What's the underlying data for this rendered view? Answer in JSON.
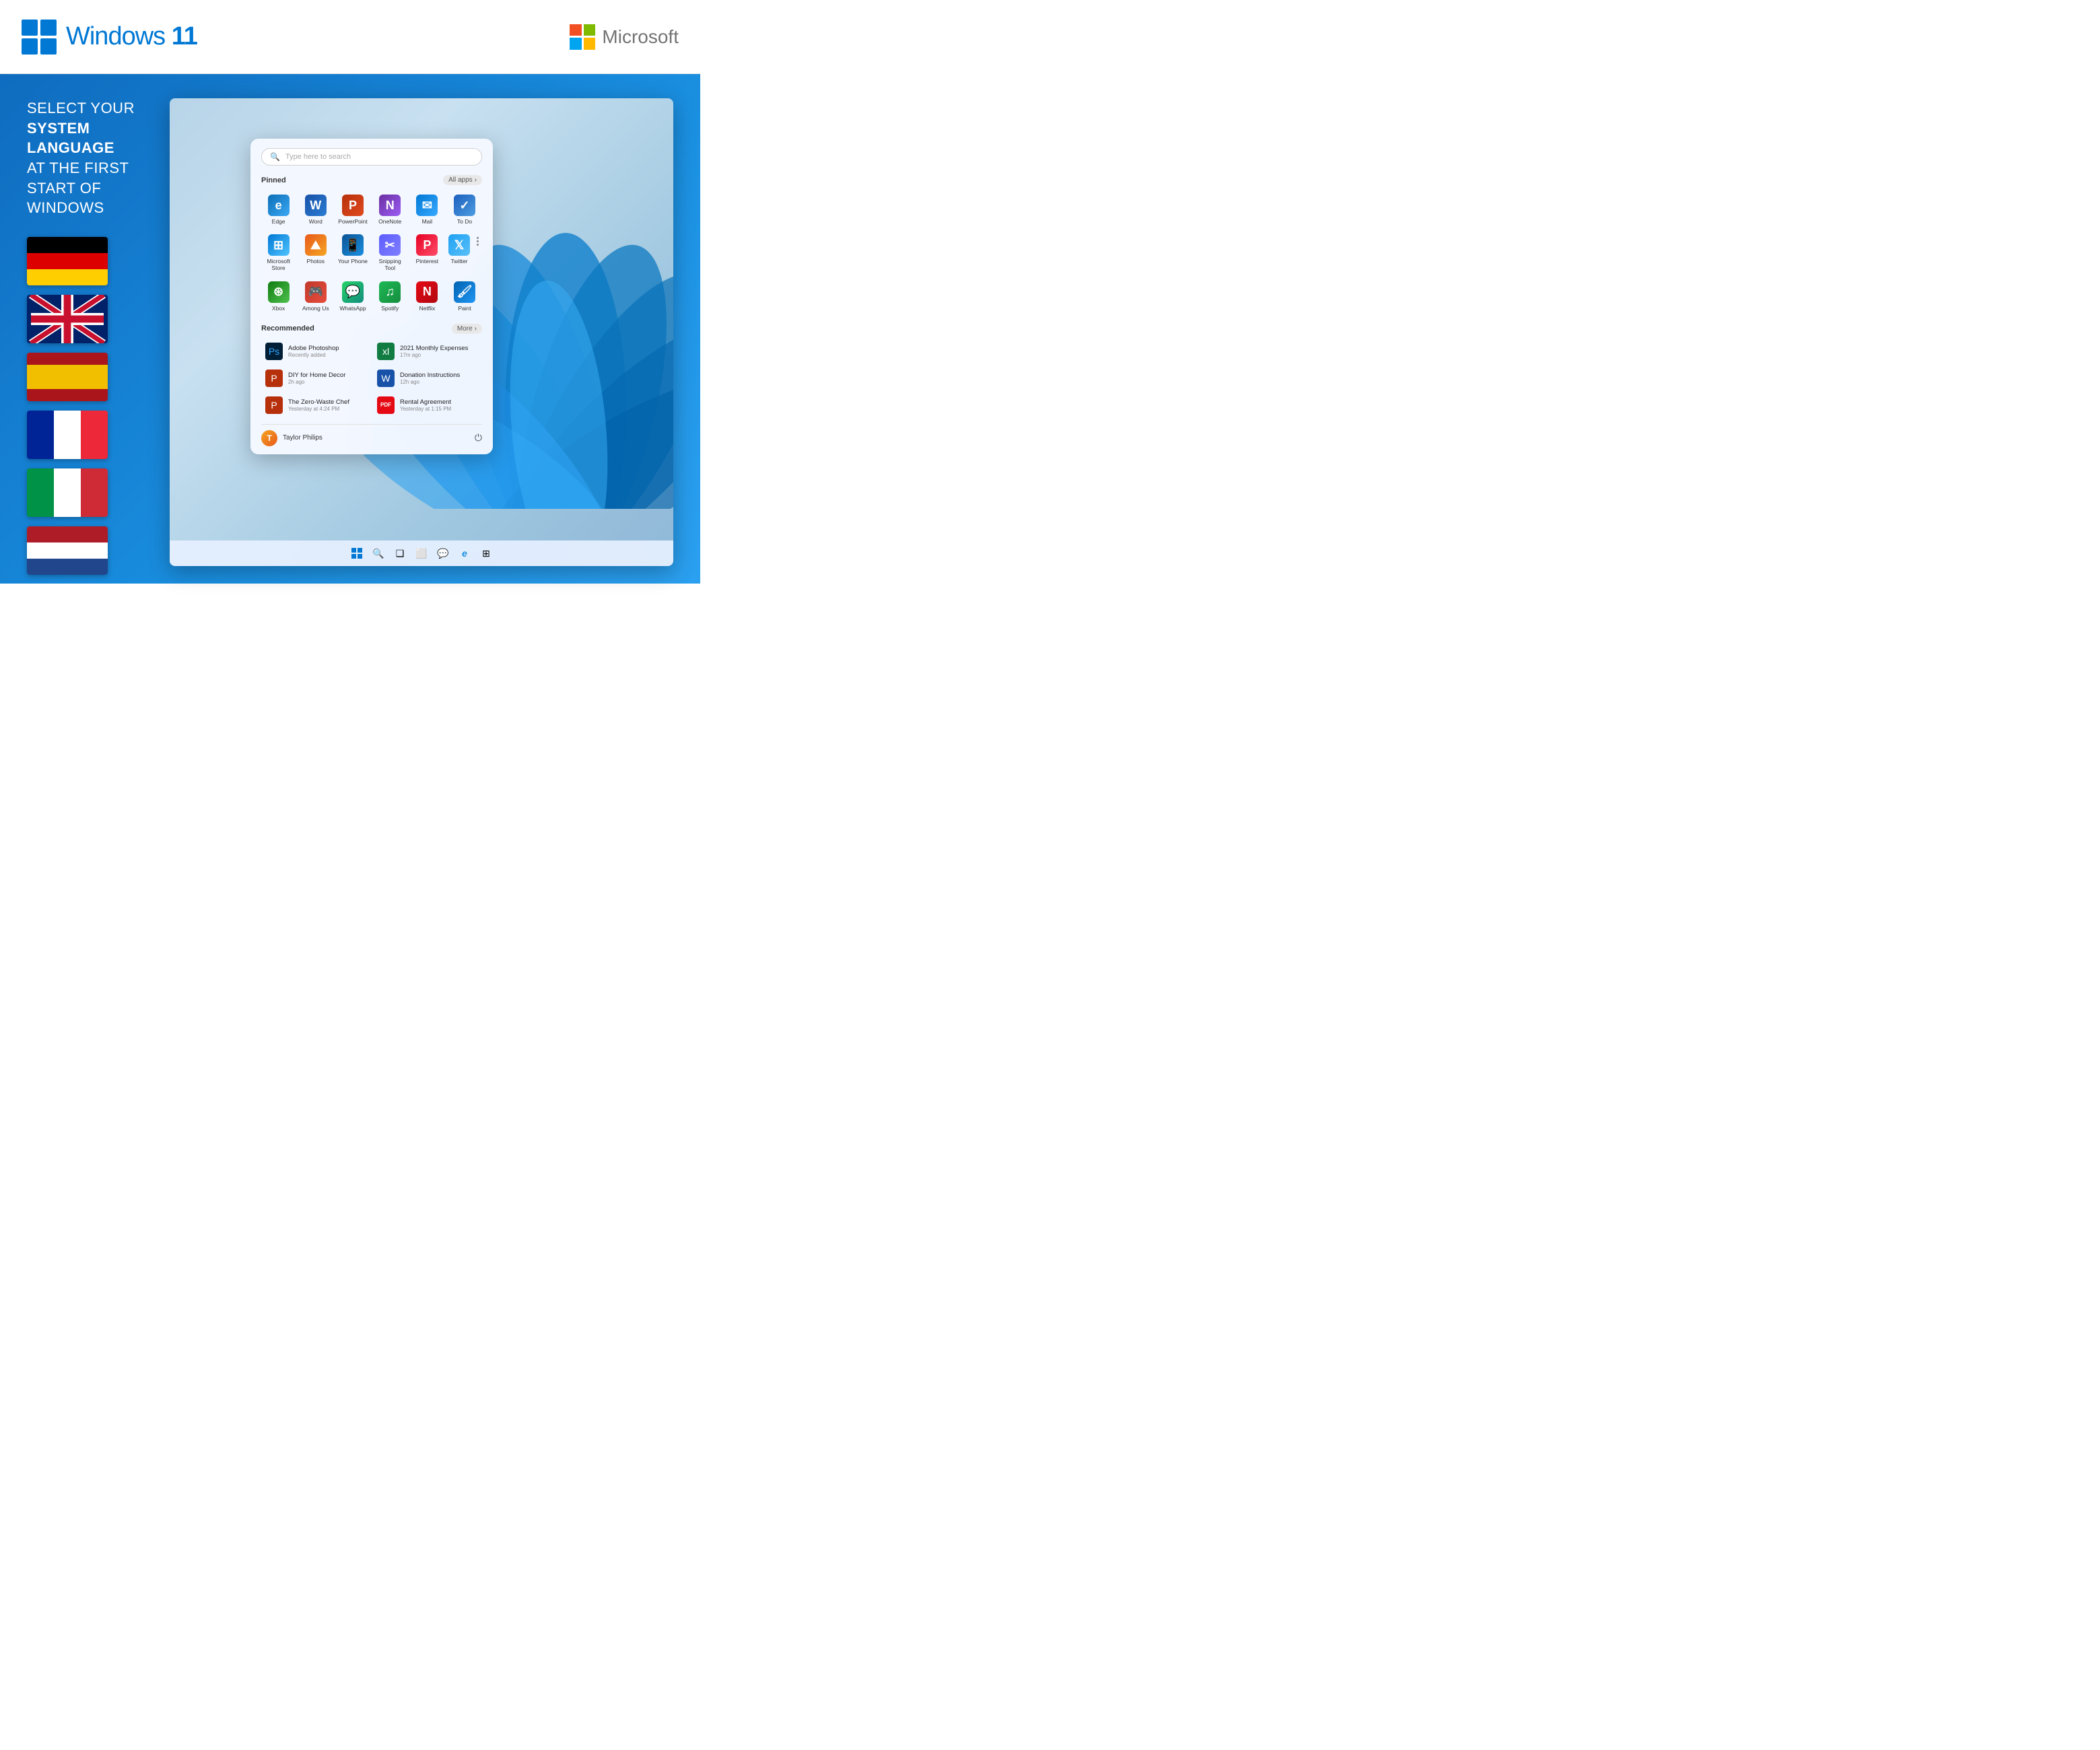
{
  "header": {
    "win11_label": "Windows",
    "win11_number": "11",
    "microsoft_label": "Microsoft"
  },
  "main": {
    "headline_normal": "SELECT YOUR ",
    "headline_bold": "SYSTEM LANGUAGE",
    "headline_line2": "AT THE FIRST START OF WINDOWS",
    "flags": [
      {
        "id": "de",
        "label": "German",
        "class": "flag-de"
      },
      {
        "id": "uk",
        "label": "English (UK)",
        "class": "flag-uk"
      },
      {
        "id": "es",
        "label": "Spanish",
        "class": "flag-es"
      },
      {
        "id": "fr",
        "label": "French",
        "class": "flag-fr"
      },
      {
        "id": "it",
        "label": "Italian",
        "class": "flag-it"
      },
      {
        "id": "nl",
        "label": "Dutch",
        "class": "flag-nl"
      }
    ]
  },
  "start_menu": {
    "search_placeholder": "Type here to search",
    "pinned_label": "Pinned",
    "all_apps_label": "All apps",
    "all_apps_arrow": "›",
    "pinned_apps": [
      {
        "id": "edge",
        "label": "Edge",
        "icon_class": "icon-edge",
        "icon_text": "e"
      },
      {
        "id": "word",
        "label": "Word",
        "icon_class": "icon-word",
        "icon_text": "W"
      },
      {
        "id": "powerpoint",
        "label": "PowerPoint",
        "icon_class": "icon-ppt",
        "icon_text": "P"
      },
      {
        "id": "onenote",
        "label": "OneNote",
        "icon_class": "icon-onenote",
        "icon_text": "N"
      },
      {
        "id": "mail",
        "label": "Mail",
        "icon_class": "icon-mail",
        "icon_text": "✉"
      },
      {
        "id": "todo",
        "label": "To Do",
        "icon_class": "icon-todo",
        "icon_text": "✓"
      },
      {
        "id": "msstore",
        "label": "Microsoft Store",
        "icon_class": "icon-msstore",
        "icon_text": "⊞"
      },
      {
        "id": "photos",
        "label": "Photos",
        "icon_class": "icon-photos",
        "icon_text": "🌄"
      },
      {
        "id": "yourphone",
        "label": "Your Phone",
        "icon_class": "icon-yourphone",
        "icon_text": "📱"
      },
      {
        "id": "snipping",
        "label": "Snipping Tool",
        "icon_class": "icon-snipping",
        "icon_text": "✂"
      },
      {
        "id": "pinterest",
        "label": "Pinterest",
        "icon_class": "icon-pinterest",
        "icon_text": "P"
      },
      {
        "id": "twitter",
        "label": "Twitter",
        "icon_class": "icon-twitter",
        "icon_text": "t"
      },
      {
        "id": "xbox",
        "label": "Xbox",
        "icon_class": "icon-xbox",
        "icon_text": "⊛"
      },
      {
        "id": "among",
        "label": "Among Us",
        "icon_class": "icon-among",
        "icon_text": "👾"
      },
      {
        "id": "whatsapp",
        "label": "WhatsApp",
        "icon_class": "icon-whatsapp",
        "icon_text": "💬"
      },
      {
        "id": "spotify",
        "label": "Spotify",
        "icon_class": "icon-spotify",
        "icon_text": "♫"
      },
      {
        "id": "netflix",
        "label": "Netflix",
        "icon_class": "icon-netflix",
        "icon_text": "N"
      },
      {
        "id": "paint",
        "label": "Paint",
        "icon_class": "icon-paint",
        "icon_text": "🖌"
      }
    ],
    "recommended_label": "Recommended",
    "more_label": "More",
    "more_arrow": "›",
    "recommended_items": [
      {
        "id": "photoshop",
        "label": "Adobe Photoshop",
        "sub": "Recently added",
        "icon_class": "rec-icon-ps",
        "icon_text": "Ps"
      },
      {
        "id": "expenses",
        "label": "2021 Monthly Expenses",
        "sub": "17m ago",
        "icon_class": "rec-icon-xl",
        "icon_text": "xl"
      },
      {
        "id": "diy",
        "label": "DIY for Home Decor",
        "sub": "2h ago",
        "icon_class": "rec-icon-ppt2",
        "icon_text": "P"
      },
      {
        "id": "donation",
        "label": "Donation Instructions",
        "sub": "12h ago",
        "icon_class": "rec-icon-wd",
        "icon_text": "W"
      },
      {
        "id": "zerowaste",
        "label": "The Zero-Waste Chef",
        "sub": "Yesterday at 4:24 PM",
        "icon_class": "rec-icon-ppt2",
        "icon_text": "P"
      },
      {
        "id": "rental",
        "label": "Rental Agreement",
        "sub": "Yesterday at 1:15 PM",
        "icon_class": "rec-icon-pdf",
        "icon_text": "PDF"
      }
    ],
    "user_name": "Taylor Philips",
    "power_icon": "⏻"
  },
  "taskbar": {
    "icons": [
      "⊞",
      "🔍",
      "❑",
      "⎬",
      "💬",
      "🌐",
      "e",
      "⊟"
    ]
  }
}
